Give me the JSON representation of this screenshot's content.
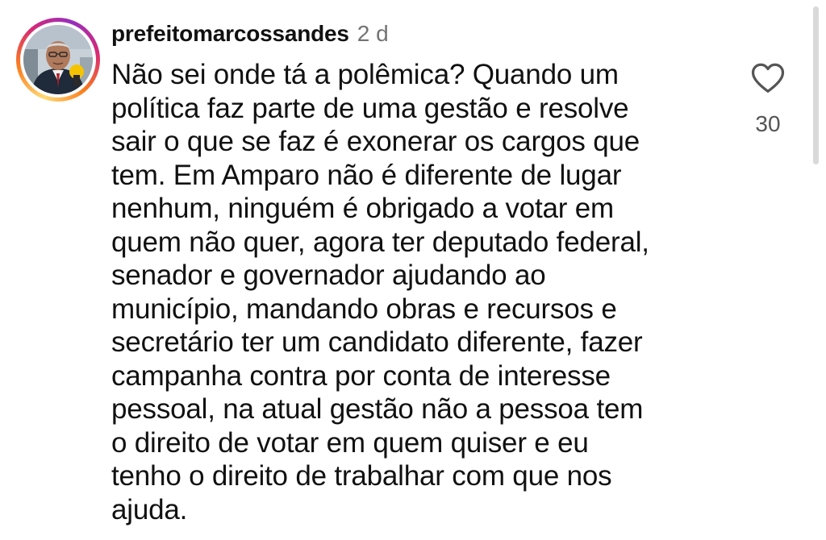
{
  "comment": {
    "username": "prefeitomarcossandes",
    "timestamp": "2 d",
    "text_lines": [
      "Não sei onde tá a polêmica? Quando um",
      "política faz parte de uma gestão e resolve",
      "sair o que se faz é exonerar os cargos que",
      "tem. Em Amparo não é diferente de lugar",
      "nenhum, ninguém é obrigado a votar em",
      "quem não quer, agora ter deputado federal,",
      "senador e governador ajudando ao",
      "município, mandando obras e recursos e",
      "secretário ter um candidato diferente, fazer",
      "campanha contra por conta de interesse",
      "pessoal, na atual gestão não a pessoa tem",
      "o direito de votar em quem quiser e eu",
      "tenho o direito de trabalhar com que nos",
      "ajuda."
    ],
    "like_count": "30",
    "like_icon": "heart-outline-icon",
    "avatar_ring_colors": [
      "#feda75",
      "#fa7e1e",
      "#d62976",
      "#962fbf"
    ]
  }
}
